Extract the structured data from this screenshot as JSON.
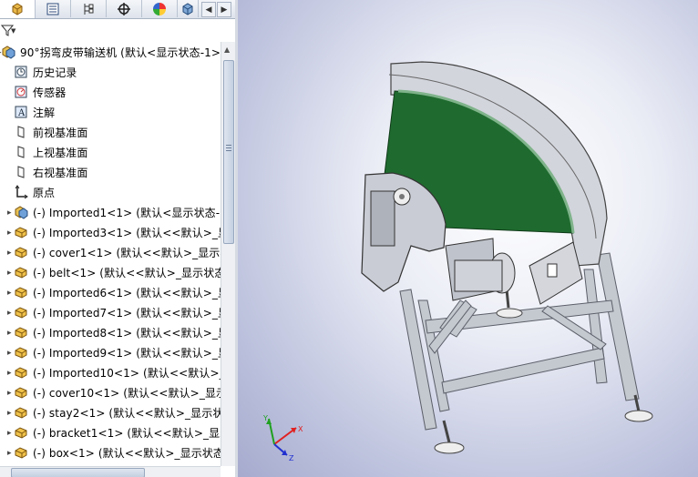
{
  "tabs": [
    {
      "name": "feature-manager",
      "icon": "part-tree-icon"
    },
    {
      "name": "property-manager",
      "icon": "property-list-icon"
    },
    {
      "name": "configuration-manager",
      "icon": "configuration-icon"
    },
    {
      "name": "dimxpert",
      "icon": "crosshair-icon"
    },
    {
      "name": "display-manager",
      "icon": "color-wheel-icon"
    },
    {
      "name": "extra",
      "icon": "cube-icon"
    }
  ],
  "nav": {
    "prev": "◀",
    "next": "▶"
  },
  "filter": {
    "icon": "filter-icon",
    "dropdown": "▼"
  },
  "tree": [
    {
      "label": "90°拐弯皮带输送机  (默认<显示状态-1>)",
      "icon": "assembly-icon"
    },
    {
      "label": "历史记录",
      "icon": "history-icon"
    },
    {
      "label": "传感器",
      "icon": "sensor-icon"
    },
    {
      "label": "注解",
      "icon": "annotation-icon"
    },
    {
      "label": "前视基准面",
      "icon": "plane-icon"
    },
    {
      "label": "上视基准面",
      "icon": "plane-icon"
    },
    {
      "label": "右视基准面",
      "icon": "plane-icon"
    },
    {
      "label": "原点",
      "icon": "origin-icon"
    },
    {
      "label": "(-) Imported1<1>  (默认<显示状态-1",
      "icon": "assembly-icon"
    },
    {
      "label": "(-) Imported3<1>  (默认<<默认>_显",
      "icon": "part-icon"
    },
    {
      "label": "(-) cover1<1>  (默认<<默认>_显示状",
      "icon": "part-icon"
    },
    {
      "label": "(-) belt<1>  (默认<<默认>_显示状态",
      "icon": "part-icon"
    },
    {
      "label": "(-) Imported6<1>  (默认<<默认>_显",
      "icon": "part-icon"
    },
    {
      "label": "(-) Imported7<1>  (默认<<默认>_显",
      "icon": "part-icon"
    },
    {
      "label": "(-) Imported8<1>  (默认<<默认>_显",
      "icon": "part-icon"
    },
    {
      "label": "(-) Imported9<1>  (默认<<默认>_显",
      "icon": "part-icon"
    },
    {
      "label": "(-) Imported10<1>  (默认<<默认>_显",
      "icon": "part-icon"
    },
    {
      "label": "(-) cover10<1>  (默认<<默认>_显示状",
      "icon": "part-icon"
    },
    {
      "label": "(-) stay2<1>  (默认<<默认>_显示状态",
      "icon": "part-icon"
    },
    {
      "label": "(-) bracket1<1>  (默认<<默认>_显示",
      "icon": "part-icon"
    },
    {
      "label": "(-) box<1>  (默认<<默认>_显示状态",
      "icon": "part-icon"
    }
  ],
  "triad": {
    "x": "X",
    "y": "Y",
    "z": "Z"
  },
  "colors": {
    "belt": "#1f6b2f",
    "frame": "#b8bcc6",
    "background": "#b9bedb",
    "axis_x": "#e02020",
    "axis_y": "#20a020",
    "axis_z": "#2030d0"
  }
}
